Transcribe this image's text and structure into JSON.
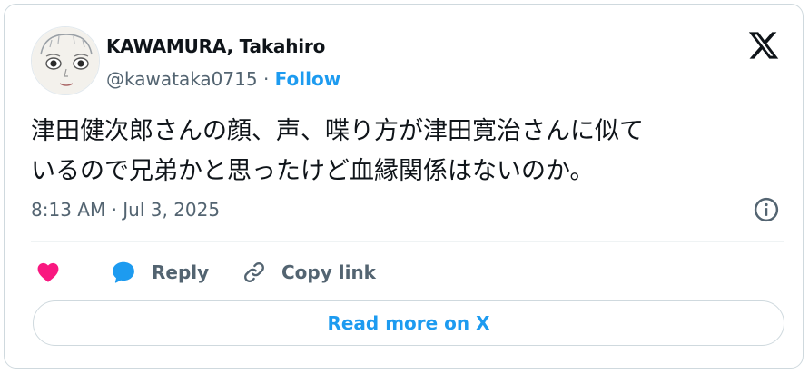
{
  "author": {
    "name": "KAWAMURA, Takahiro",
    "handle": "@kawataka0715",
    "separator": " · ",
    "follow_label": "Follow",
    "avatar_icon": "illustrated-face-avatar"
  },
  "header": {
    "logo_icon": "x-logo-icon"
  },
  "tweet": {
    "lines": [
      "津田健次郎さんの顔、声、喋り方が津田寛治さんに似て",
      "いるので兄弟かと思ったけど血縁関係はないのか。"
    ]
  },
  "timestamp": "8:13 AM · Jul 3, 2025",
  "actions": {
    "like_icon": "heart-icon",
    "reply_label": "Reply",
    "reply_icon": "speech-bubble-icon",
    "copy_label": "Copy link",
    "copy_icon": "link-icon"
  },
  "read_more_label": "Read more on X",
  "colors": {
    "accent": "#1d9bf0",
    "like": "#f91880",
    "text_primary": "#0f1419",
    "text_secondary": "#536471",
    "border": "#cfd9de"
  }
}
